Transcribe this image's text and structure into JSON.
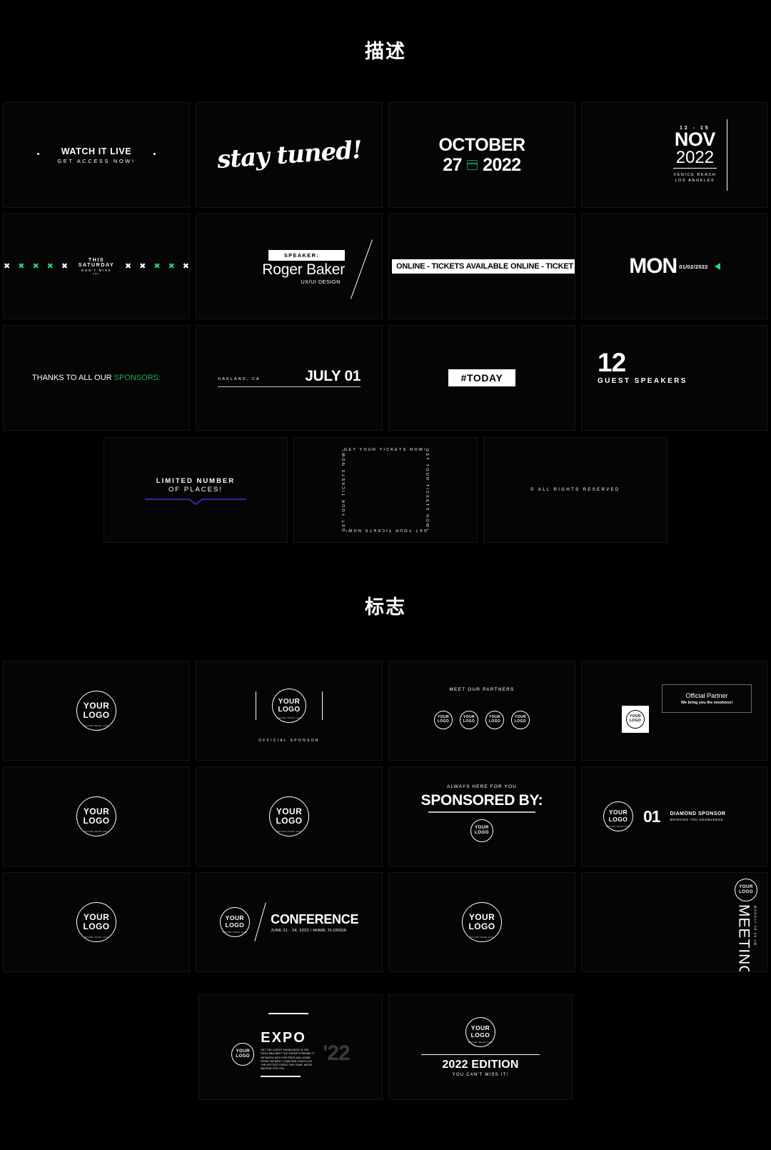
{
  "sections": {
    "description": {
      "title": "描述"
    },
    "logo": {
      "title": "标志"
    }
  },
  "colors": {
    "background": "#000000",
    "accent_green": "#1fa85c",
    "accent_green_bright": "#1fd97b",
    "accent_purple": "#4b2fd6",
    "white": "#ffffff"
  },
  "description_cards": {
    "watch_live": {
      "title": "WATCH IT LIVE",
      "subtitle": "GET ACCESS NOW!"
    },
    "stay_tuned": {
      "text": "stay tuned!"
    },
    "october": {
      "month": "OCTOBER",
      "day": "27",
      "year": "2022",
      "icon": "calendar-icon"
    },
    "nov": {
      "days": "12 - 15",
      "month": "NOV",
      "year": "2022",
      "location_line1": "VENICE BEACH",
      "location_line2": "LOS ANGELES"
    },
    "saturday": {
      "title": "THIS SATURDAY",
      "subtitle": "DON'T MISS IT!"
    },
    "speaker": {
      "label": "SPEAKER:",
      "name": "Roger Baker",
      "role": "UX/UI DESIGN"
    },
    "online_ticker": {
      "text": "ONLINE - TICKETS AVAILABLE ONLINE - TICKET"
    },
    "mon": {
      "day": "MON",
      "date": "01/02/2022",
      "icon": "play-triangle-icon"
    },
    "sponsors": {
      "prefix": "THANKS TO ALL OUR ",
      "highlight": "SPONSORS:"
    },
    "july": {
      "city": "OAKLAND, CA",
      "date": "JULY 01"
    },
    "today": {
      "text": "#TODAY"
    },
    "guests": {
      "number": "12",
      "label": "GUEST SPEAKERS"
    },
    "limited": {
      "line1": "LIMITED NUMBER",
      "line2": "OF PLACES!"
    },
    "tickets_frame": {
      "text": "GET YOUR TICKETS NOW!"
    },
    "rights": {
      "text": "© ALL RIGHTS RESERVED"
    }
  },
  "logo_badge": {
    "line1": "YOUR",
    "line2": "LOGO",
    "arc_text": "ESTABLISHED 2022"
  },
  "logo_cards": {
    "plain": {},
    "official_sponsor": {
      "caption": "OFFICIAL SPONSOR"
    },
    "partners": {
      "heading": "MEET OUR PARTNERS",
      "count": 4
    },
    "official_partner": {
      "title": "Official Partner",
      "subtitle": "We bring you the emotions!"
    },
    "sponsored_by": {
      "eyebrow": "ALWAYS HERE FOR YOU",
      "title": "SPONSORED BY:"
    },
    "diamond": {
      "number": "01",
      "title": "DIAMOND SPONSOR",
      "subtitle": "BRINGING YOU KNOWLEDGE"
    },
    "conference": {
      "title": "CONFERENCE",
      "subtitle": "JUNE 21 - 24, 2022 / MIAMI, FLORIDA"
    },
    "meeting": {
      "title": "MEETING",
      "subtitle": "MONDAY 08:00 AM"
    },
    "expo": {
      "title": "EXPO",
      "year": "'22",
      "body": "GET THE LATEST KNOWLEDGE IN THE FIELD AND MEET THE EXPERTS BEHIND IT. NETWORK WITH THE PROS AND LEARN FROM THE BEST. COME AND CHECK OUT THE HOTTEST EVENT THIS YEAR. WE'RE WAITING FOR YOU."
    },
    "edition": {
      "title": "2022 EDITION",
      "subtitle": "YOU CAN'T MISS IT!"
    }
  }
}
